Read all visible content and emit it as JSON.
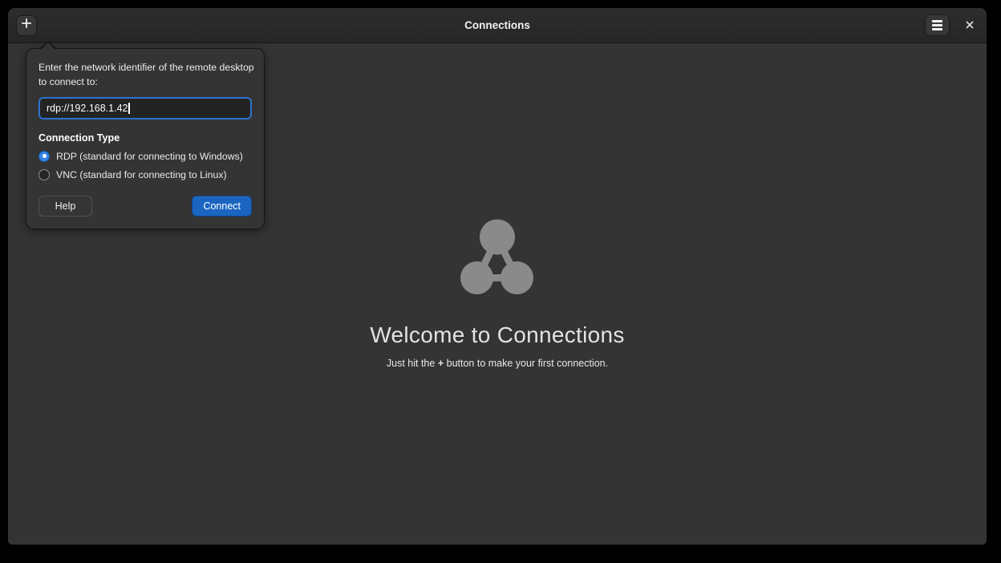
{
  "window": {
    "title": "Connections"
  },
  "popover": {
    "prompt": "Enter the network identifier of the remote desktop to connect to:",
    "address_value": "rdp://192.168.1.42",
    "section_title": "Connection Type",
    "connection_types": [
      {
        "label": "RDP (standard for connecting to Windows)",
        "selected": true
      },
      {
        "label": "VNC (standard for connecting to Linux)",
        "selected": false
      }
    ],
    "help_label": "Help",
    "connect_label": "Connect"
  },
  "empty_state": {
    "title": "Welcome to Connections",
    "subtitle_prefix": "Just hit the ",
    "subtitle_plus": "+",
    "subtitle_suffix": " button to make your first connection."
  },
  "icons": {
    "plus": "plus-icon",
    "menu": "hamburger-menu-icon",
    "close": "close-icon",
    "network": "network-nodes-icon"
  },
  "colors": {
    "accent_blue": "#3584e4",
    "suggested_action": "#1b65c0",
    "icon_gray": "#8a8a8a",
    "window_bg": "#343434",
    "headerbar_bg": "#2a2a2a"
  }
}
